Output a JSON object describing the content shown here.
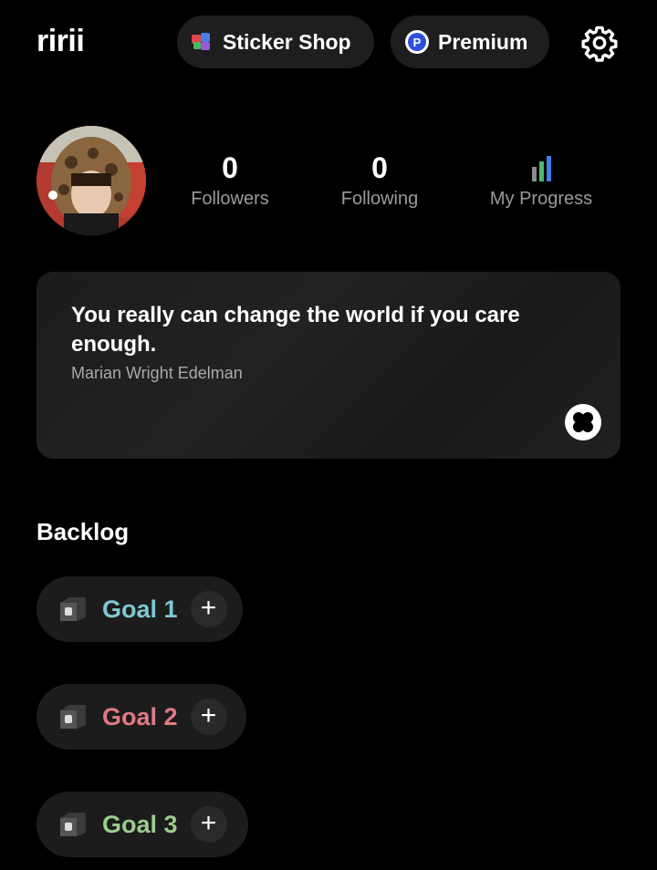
{
  "header": {
    "app_title": "ririi",
    "sticker_shop_label": "Sticker Shop",
    "premium_label": "Premium",
    "premium_icon_letter": "P",
    "settings_icon": "gear-icon"
  },
  "profile": {
    "followers_value": "0",
    "followers_label": "Followers",
    "following_value": "0",
    "following_label": "Following",
    "progress_label": "My Progress",
    "progress_icon": "bar-chart-icon"
  },
  "quote": {
    "text": "You really can change the world if you care enough.",
    "author": "Marian Wright Edelman",
    "shuffle_icon": "shuffle-icon"
  },
  "backlog": {
    "title": "Backlog",
    "goals": [
      {
        "label": "Goal 1",
        "color": "#7ec8d0"
      },
      {
        "label": "Goal 2",
        "color": "#e07a85"
      },
      {
        "label": "Goal 3",
        "color": "#9ccc8e"
      }
    ],
    "add_symbol": "+"
  },
  "colors": {
    "background": "#000000",
    "card": "#1c1c1c",
    "muted_text": "#9a9a9a"
  }
}
